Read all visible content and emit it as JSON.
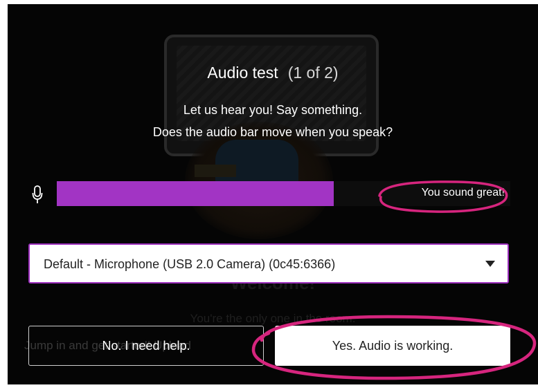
{
  "dialog": {
    "title": "Audio test",
    "step": "(1 of 2)",
    "prompt_line1": "Let us hear you! Say something.",
    "prompt_line2": "Does the audio bar move when you speak?"
  },
  "meter": {
    "icon": "microphone-icon",
    "level_fraction": 0.61,
    "fill_color": "#a234c4",
    "status_text": "You sound great!"
  },
  "device_select": {
    "selected": "Default - Microphone (USB 2.0 Camera) (0c45:6366)",
    "border_color": "#9c2fbd"
  },
  "buttons": {
    "help_label": "No. I need help.",
    "yes_label": "Yes. Audio is working."
  },
  "background": {
    "welcome": "Welcome!",
    "only_one": "You're the only one in the room.",
    "jump_in": "Jump in and get started! Upload"
  },
  "annotation_color": "#d6257e"
}
